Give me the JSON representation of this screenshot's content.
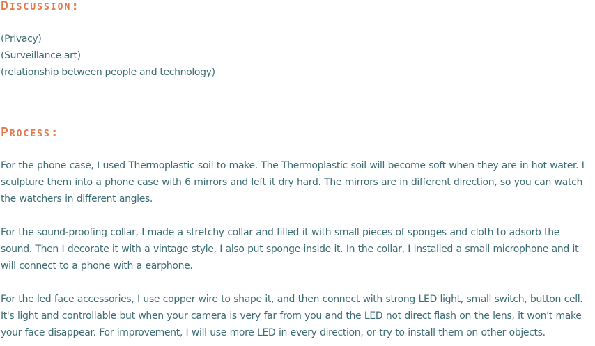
{
  "discussion": {
    "heading": "Discussion:",
    "topics": [
      "(Privacy)",
      "(Surveillance art)",
      "(relationship between people and technology)"
    ]
  },
  "process": {
    "heading": "Process:",
    "paragraphs": [
      "For the phone case, I used Thermoplastic soil to make. The Thermoplastic soil will become soft when they are in hot water. I sculpture them into a phone case with 6 mirrors and left it dry hard. The mirrors are in different direction, so you can watch the watchers in different angles.",
      "For the sound-proofing collar, I made a stretchy collar and filled it with small pieces of sponges and cloth to adsorb the sound. Then I decorate it with a vintage style, I also put sponge inside it. In the collar, I installed a small microphone and it will connect to a phone with a earphone.",
      "For the led face accessories, I use copper wire to shape it, and then connect with strong LED light, small switch, button cell. It's light and controllable but when your camera is very far from you and the LED not direct flash on the lens, it won't make your face disappear. For improvement, I will use more LED in every direction, or try to install them on other objects."
    ]
  },
  "colors": {
    "heading": "#e27a4c",
    "body_text": "#3c6c73",
    "background": "#ffffff"
  }
}
